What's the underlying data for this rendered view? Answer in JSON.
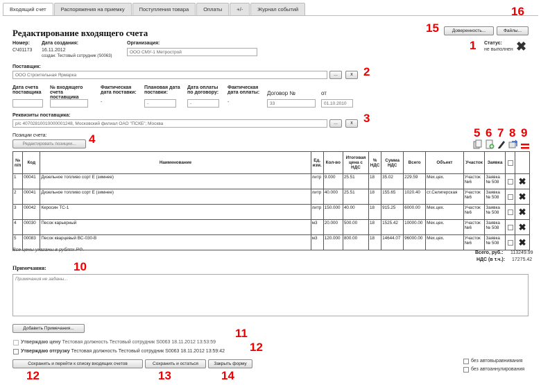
{
  "tabs": [
    "Входящий счет",
    "Распоряжения на приемку",
    "Поступления товара",
    "Оплаты",
    "+/-",
    "Журнал событий"
  ],
  "page_title": "Редактирование входящего счета",
  "top_buttons": {
    "trust": "Доверенность...",
    "files": "Файлы..."
  },
  "doc": {
    "number_label": "Номер:",
    "number": "СЧ01173",
    "created_label": "Дата создания:",
    "created": "16.11.2012",
    "created_by": "создан: Тестовый сотрудник (S0063)",
    "org_label": "Организация:",
    "org": "ООО СМУ-1 Метрострой",
    "status_label": "Статус:",
    "status": "не выполнен"
  },
  "supplier": {
    "label": "Поставщик:",
    "value": "ООО Строительная Ярмарка",
    "btn_more": "...",
    "btn_clear": "x"
  },
  "dates": {
    "l1": "Дата счета поставщика",
    "l2": "№ входящего счета поставщика",
    "l3": "Фактическая дата поставки:",
    "v3": "-",
    "l4": "Плановая дата поставки:",
    "v4": "-",
    "l5": "Дата оплаты по договору:",
    "v5": "-",
    "l6": "Фактическая дата оплаты:",
    "v6": "-",
    "contract_label": "Договор №",
    "contract": "33",
    "from_label": "от",
    "from": "01.10.2010"
  },
  "requisites": {
    "label": "Реквизиты поставщика:",
    "value": "р/с 40702810010000001248, Московский филиал ОАО \"ПСКБ\"; Москва",
    "btn_more": "...",
    "btn_clear": "x"
  },
  "positions": {
    "label": "Позиции счета:",
    "edit_btn": "Редактировать позиции..."
  },
  "table": {
    "headers": [
      "№ п/п",
      "Код",
      "Наименование",
      "Ед. изм.",
      "Кол-во",
      "Итоговая цена с НДС",
      "% НДС",
      "Сумма НДС",
      "Всего",
      "Объект",
      "Участок",
      "Заявка",
      "",
      ""
    ],
    "rows": [
      [
        "1",
        "00041",
        "Дизельное топливо сорт Е (зимнее)",
        "литр",
        "9.000",
        "25.51",
        "18",
        "35.02",
        "229.59",
        "Мех.цех.",
        "Участок №6",
        "Заявка № 508"
      ],
      [
        "2",
        "00041",
        "Дизельное топливо сорт Е (зимнее)",
        "литр",
        "40.000",
        "25.51",
        "18",
        "155.65",
        "1020.40",
        "ст.Селигерская",
        "Участок №6",
        "Заявка № 508"
      ],
      [
        "3",
        "00042",
        "Керосин ТС-1",
        "литр",
        "150.000",
        "40.00",
        "18",
        "915.25",
        "6000.00",
        "Мех.цех.",
        "Участок №6",
        "Заявка № 508"
      ],
      [
        "4",
        "00030",
        "Песок карьерный",
        "м3",
        "20.000",
        "500.00",
        "18",
        "1525.42",
        "10000.00",
        "Мех.цех.",
        "Участок №6",
        "Заявка № 508"
      ],
      [
        "5",
        "00083",
        "Песок кварцевый ВС-030-В",
        "м3",
        "120.000",
        "800.00",
        "18",
        "14644.07",
        "96000.00",
        "Мех.цех.",
        "Участок №6",
        "Заявка № 508"
      ]
    ]
  },
  "note_rub": "Все цены указаны в рублях РФ.",
  "totals": {
    "total_label": "Всего, руб.:",
    "total": "113249.99",
    "vat_label": "НДС (в т.ч.):",
    "vat": "17275.42"
  },
  "notes": {
    "label": "Примечания:",
    "placeholder": "Примечания не заданы...",
    "add_btn": "Добавить Примечания..."
  },
  "approvals": {
    "price_label": "Утверждаю цену",
    "price_info": "Тестовая должность Тестовый сотрудник S0063 18.11.2012 13:53:59",
    "ship_label": "Утверждаю отгрузку",
    "ship_info": "Тестовая должность Тестовый сотрудник S0063 18.11.2012 13:59:42"
  },
  "footer": {
    "save_go": "Сохранить и перейти к списку входящих счетов",
    "save_stay": "Сохранить и остаться",
    "close": "Закрыть форму",
    "no_align": "без автовыравнивания",
    "no_cancel": "без автоаннулирования"
  },
  "markers": {
    "m1": "1",
    "m2": "2",
    "m3": "3",
    "m4": "4",
    "m5": "5",
    "m6": "6",
    "m7": "7",
    "m8": "8",
    "m9": "9",
    "m10": "10",
    "m11": "11",
    "m12a": "12",
    "m12b": "12",
    "m13": "13",
    "m14": "14",
    "m15": "15",
    "m16": "16"
  }
}
